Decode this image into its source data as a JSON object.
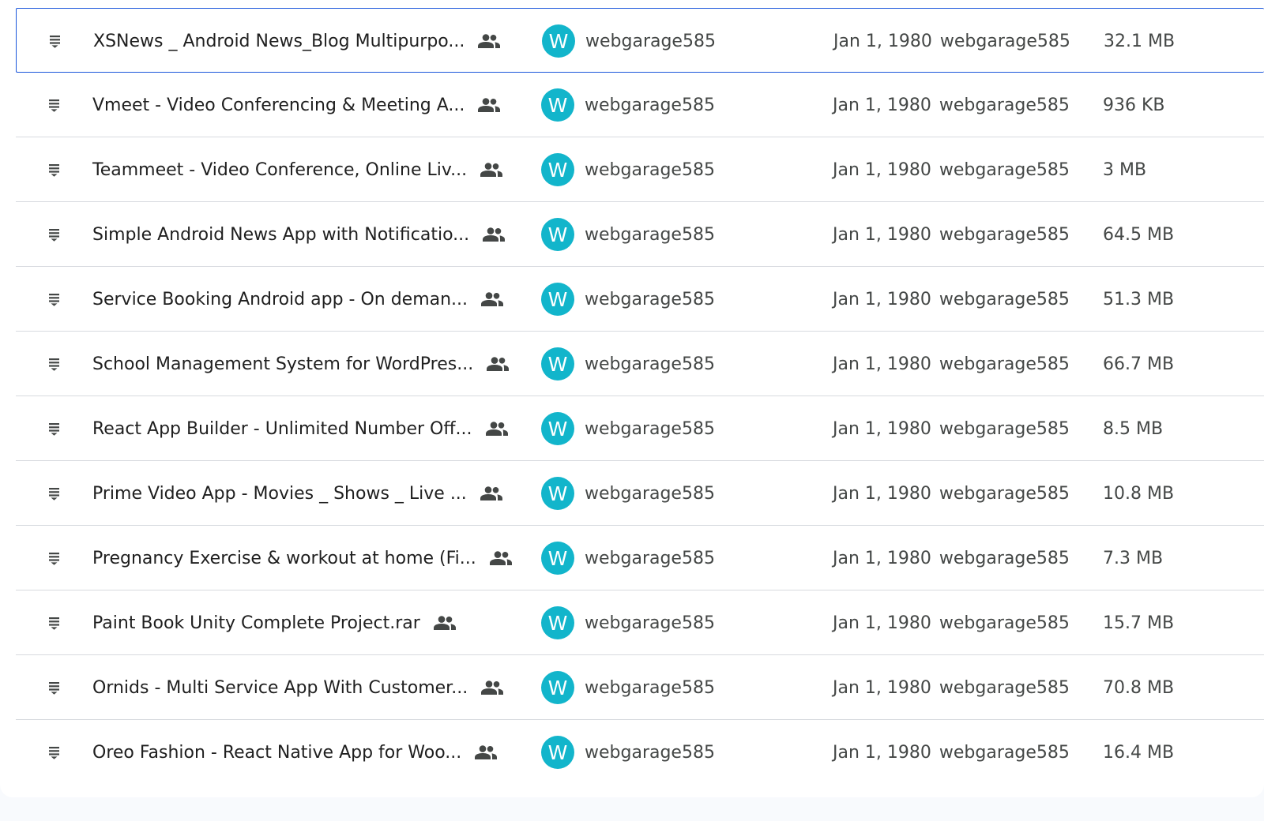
{
  "files": [
    {
      "name": "XSNews _ Android News_Blog Multipurpo...",
      "owner": "webgarage585",
      "owner_initial": "W",
      "modified_date": "Jan 1, 1980",
      "modified_by": "webgarage585",
      "size": "32.1 MB",
      "shared": true,
      "selected": true
    },
    {
      "name": "Vmeet - Video Conferencing & Meeting A...",
      "owner": "webgarage585",
      "owner_initial": "W",
      "modified_date": "Jan 1, 1980",
      "modified_by": "webgarage585",
      "size": "936 KB",
      "shared": true
    },
    {
      "name": "Teammeet - Video Conference, Online Liv...",
      "owner": "webgarage585",
      "owner_initial": "W",
      "modified_date": "Jan 1, 1980",
      "modified_by": "webgarage585",
      "size": "3 MB",
      "shared": true
    },
    {
      "name": "Simple Android News App with Notificatio...",
      "owner": "webgarage585",
      "owner_initial": "W",
      "modified_date": "Jan 1, 1980",
      "modified_by": "webgarage585",
      "size": "64.5 MB",
      "shared": true
    },
    {
      "name": "Service Booking Android app - On deman...",
      "owner": "webgarage585",
      "owner_initial": "W",
      "modified_date": "Jan 1, 1980",
      "modified_by": "webgarage585",
      "size": "51.3 MB",
      "shared": true
    },
    {
      "name": "School Management System for WordPres...",
      "owner": "webgarage585",
      "owner_initial": "W",
      "modified_date": "Jan 1, 1980",
      "modified_by": "webgarage585",
      "size": "66.7 MB",
      "shared": true
    },
    {
      "name": "React App Builder - Unlimited Number Off...",
      "owner": "webgarage585",
      "owner_initial": "W",
      "modified_date": "Jan 1, 1980",
      "modified_by": "webgarage585",
      "size": "8.5 MB",
      "shared": true
    },
    {
      "name": "Prime Video App - Movies _ Shows _ Live ...",
      "owner": "webgarage585",
      "owner_initial": "W",
      "modified_date": "Jan 1, 1980",
      "modified_by": "webgarage585",
      "size": "10.8 MB",
      "shared": true
    },
    {
      "name": "Pregnancy Exercise & workout at home (Fi...",
      "owner": "webgarage585",
      "owner_initial": "W",
      "modified_date": "Jan 1, 1980",
      "modified_by": "webgarage585",
      "size": "7.3 MB",
      "shared": true
    },
    {
      "name": "Paint Book Unity Complete Project.rar",
      "owner": "webgarage585",
      "owner_initial": "W",
      "modified_date": "Jan 1, 1980",
      "modified_by": "webgarage585",
      "size": "15.7 MB",
      "shared": true,
      "short_name": true
    },
    {
      "name": "Ornids - Multi Service App With Customer...",
      "owner": "webgarage585",
      "owner_initial": "W",
      "modified_date": "Jan 1, 1980",
      "modified_by": "webgarage585",
      "size": "70.8 MB",
      "shared": true
    },
    {
      "name": "Oreo Fashion - React Native App for Woo...",
      "owner": "webgarage585",
      "owner_initial": "W",
      "modified_date": "Jan 1, 1980",
      "modified_by": "webgarage585",
      "size": "16.4 MB",
      "shared": true
    }
  ],
  "icons": {
    "file_type": "document-lines-icon",
    "shared": "people-icon"
  },
  "colors": {
    "avatar": "#12b5cb",
    "selection_border": "#1a56db",
    "primary_text": "#1f1f1f",
    "secondary_text": "#444746",
    "divider": "#d7dadf"
  }
}
